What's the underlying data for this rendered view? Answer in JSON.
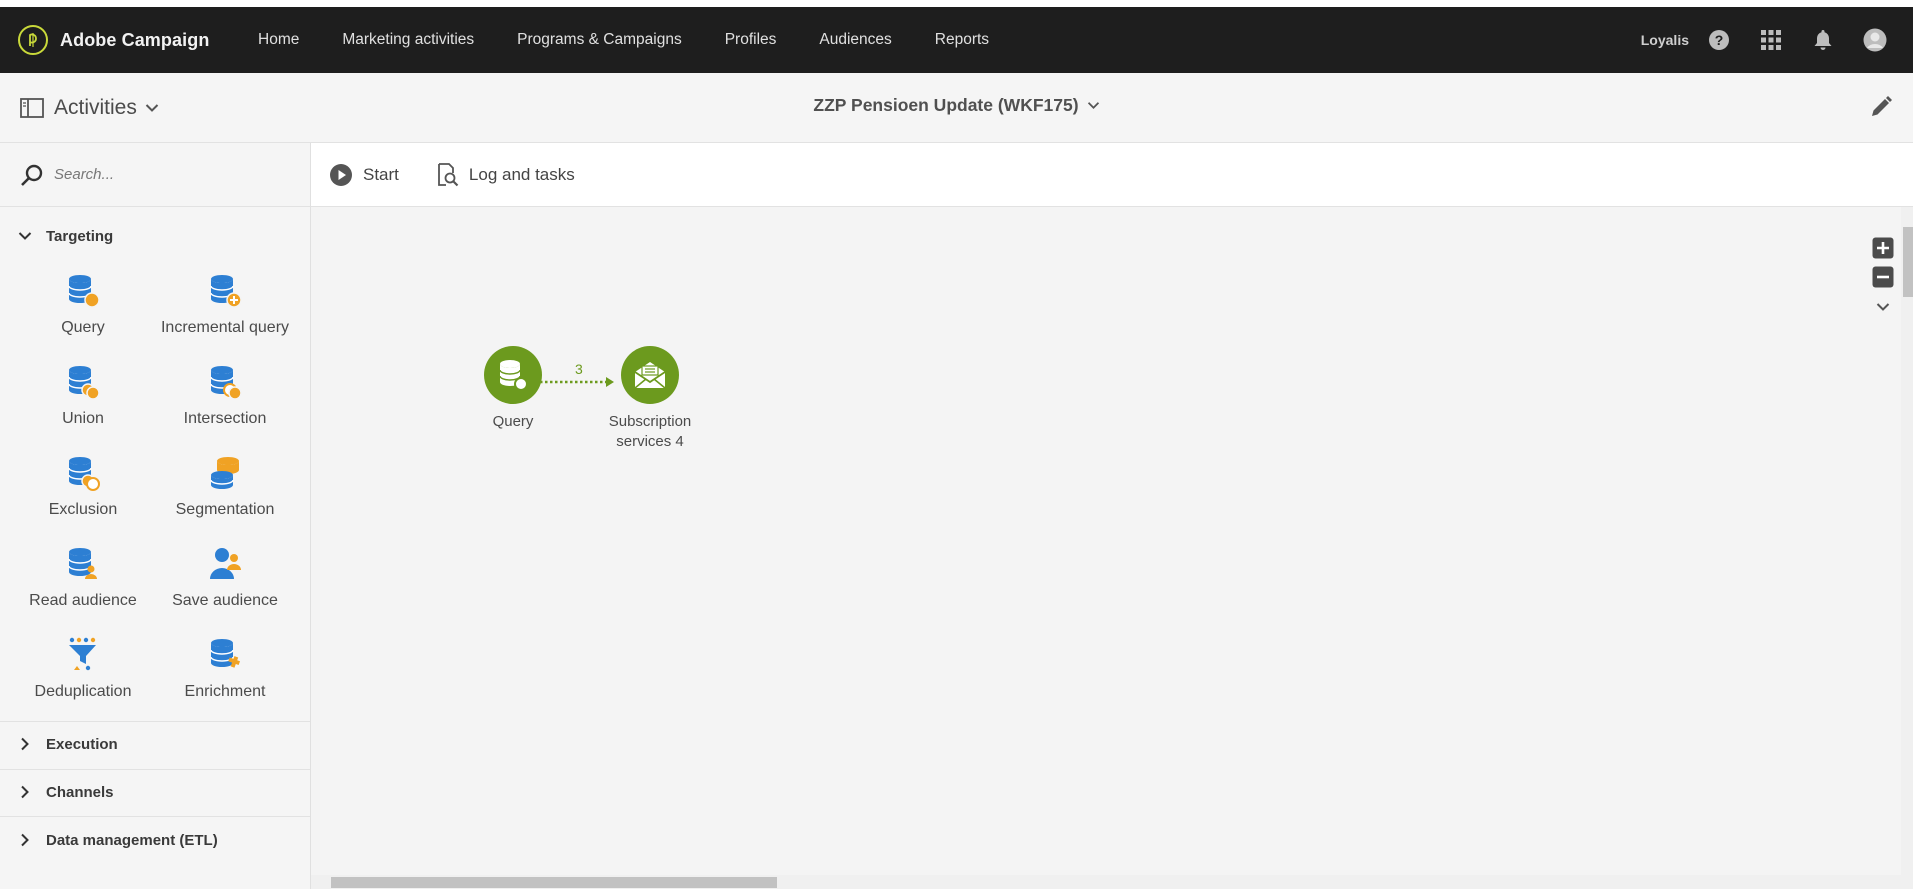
{
  "app": {
    "brand_name": "Adobe Campaign",
    "org_name": "Loyalis"
  },
  "nav": {
    "items": [
      {
        "label": "Home"
      },
      {
        "label": "Marketing activities"
      },
      {
        "label": "Programs & Campaigns"
      },
      {
        "label": "Profiles"
      },
      {
        "label": "Audiences"
      },
      {
        "label": "Reports"
      }
    ]
  },
  "subheader": {
    "activities_label": "Activities",
    "workflow_title": "ZZP Pensioen Update (WKF175)"
  },
  "sidebar": {
    "search_placeholder": "Search...",
    "sections": [
      {
        "label": "Targeting",
        "expanded": true
      },
      {
        "label": "Execution",
        "expanded": false
      },
      {
        "label": "Channels",
        "expanded": false
      },
      {
        "label": "Data management (ETL)",
        "expanded": false
      }
    ],
    "targeting_items": [
      {
        "label": "Query",
        "icon": "query-icon"
      },
      {
        "label": "Incremental query",
        "icon": "incremental-query-icon"
      },
      {
        "label": "Union",
        "icon": "union-icon"
      },
      {
        "label": "Intersection",
        "icon": "intersection-icon"
      },
      {
        "label": "Exclusion",
        "icon": "exclusion-icon"
      },
      {
        "label": "Segmentation",
        "icon": "segmentation-icon"
      },
      {
        "label": "Read audience",
        "icon": "read-audience-icon"
      },
      {
        "label": "Save audience",
        "icon": "save-audience-icon"
      },
      {
        "label": "Deduplication",
        "icon": "deduplication-icon"
      },
      {
        "label": "Enrichment",
        "icon": "enrichment-icon"
      }
    ]
  },
  "toolbar": {
    "start_label": "Start",
    "log_label": "Log and tasks"
  },
  "workflow": {
    "nodes": [
      {
        "label": "Query",
        "icon": "query-node-icon"
      },
      {
        "label": "Subscription services 4",
        "label_line1": "Subscription",
        "label_line2": "services 4",
        "icon": "envelope-icon"
      }
    ],
    "transition_count": "3"
  },
  "colors": {
    "topbar": "#1e1e1e",
    "node_green": "#6c9a1e",
    "icon_blue": "#2d7fd3",
    "icon_orange": "#f0a224"
  }
}
